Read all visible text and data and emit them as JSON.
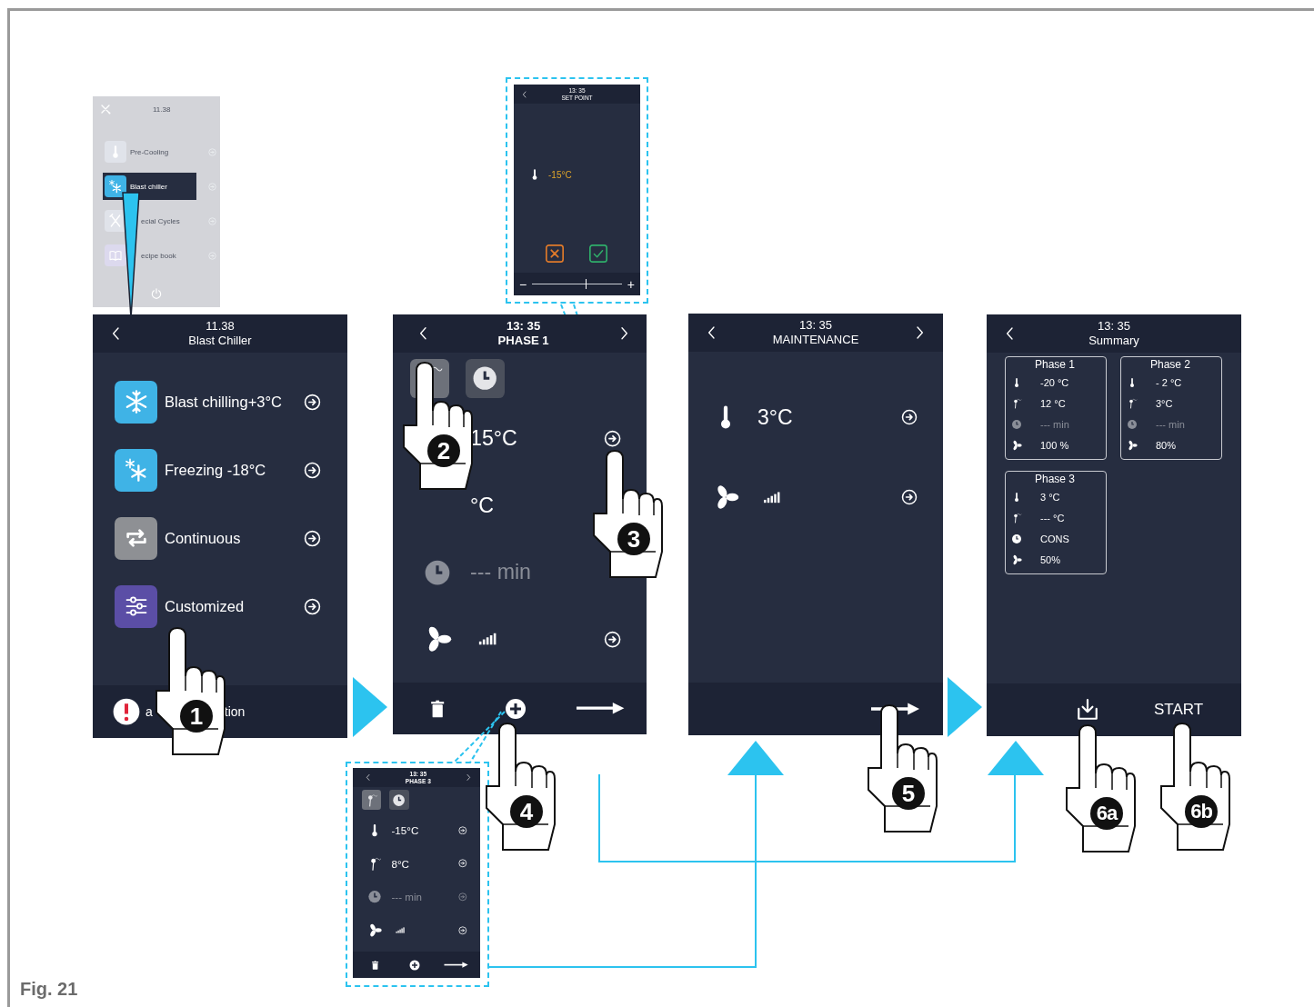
{
  "home_screen": {
    "time": "11.38",
    "items": [
      {
        "label": "Pre-Cooling",
        "kind": "precool",
        "selected": false
      },
      {
        "label": "Blast chiller",
        "kind": "chill",
        "selected": true
      },
      {
        "label": "ecial Cycles",
        "kind": "special",
        "selected": false
      },
      {
        "label": "ecipe book",
        "kind": "recipes",
        "selected": false
      }
    ]
  },
  "menu_screen": {
    "time": "11.38",
    "title": "Blast Chiller",
    "items": [
      {
        "label": "Blast chilling+3°C",
        "kind": "chill"
      },
      {
        "label": "Freezing -18°C",
        "kind": "freeze"
      },
      {
        "label": "Continuous",
        "kind": "continuous"
      },
      {
        "label": "Customized",
        "kind": "custom"
      }
    ],
    "footer": [
      "a",
      "tion"
    ]
  },
  "setpoint_screen": {
    "time": "13: 35",
    "title": "SET POINT",
    "value": "-15°C",
    "minus": "−",
    "plus": "+",
    "slider": {
      "level": 0.6
    }
  },
  "phase_screen": {
    "time": "13: 35",
    "title": "PHASE 1",
    "modes": [
      {
        "kind": "probe",
        "selected": true
      },
      {
        "kind": "timer",
        "selected": false
      }
    ],
    "rows": [
      {
        "value": "15°C",
        "disabled": false,
        "arrow": true
      },
      {
        "value": "°C",
        "disabled": false,
        "arrow": false
      },
      {
        "kind": "time",
        "value": "--- min",
        "disabled": true,
        "arrow": false
      },
      {
        "kind": "fan",
        "disabled": false,
        "arrow": true
      }
    ]
  },
  "phase3_screen": {
    "time": "13: 35",
    "title": "PHASE 3",
    "modes": [
      {
        "kind": "probe",
        "selected": true
      },
      {
        "kind": "timer",
        "selected": false
      }
    ],
    "rows": [
      {
        "kind": "air_temp",
        "value": "-15°C",
        "disabled": false,
        "arrow": true
      },
      {
        "kind": "probe_temp",
        "value": "8°C",
        "disabled": false,
        "arrow": true
      },
      {
        "kind": "time",
        "value": "--- min",
        "disabled": true,
        "arrow": true
      },
      {
        "kind": "fan",
        "disabled": false,
        "arrow": true
      }
    ]
  },
  "maintenance_screen": {
    "time": "13: 35",
    "title": "MAINTENANCE",
    "rows": [
      {
        "kind": "air_temp",
        "value": "3°C"
      },
      {
        "kind": "fan"
      }
    ]
  },
  "summary_screen": {
    "time": "13: 35",
    "title": "Summary",
    "phases": [
      {
        "name": "Phase 1",
        "lines": [
          {
            "kind": "air_temp",
            "value": "-20 °C",
            "disabled": false
          },
          {
            "kind": "probe_temp",
            "value": "12 °C",
            "disabled": false
          },
          {
            "kind": "time",
            "value": "--- min",
            "disabled": true
          },
          {
            "kind": "fan",
            "value": "100 %",
            "disabled": false
          }
        ]
      },
      {
        "name": "Phase 2",
        "lines": [
          {
            "kind": "air_temp",
            "value": "- 2 °C",
            "disabled": false
          },
          {
            "kind": "probe_temp",
            "value": "3°C",
            "disabled": false
          },
          {
            "kind": "time",
            "value": "--- min",
            "disabled": true
          },
          {
            "kind": "fan",
            "value": "80%",
            "disabled": false
          }
        ]
      },
      {
        "name": "Phase 3",
        "lines": [
          {
            "kind": "air_temp",
            "value": "3 °C",
            "disabled": false
          },
          {
            "kind": "probe_temp",
            "value": "--- °C",
            "disabled": false
          },
          {
            "kind": "time",
            "value": "CONS",
            "disabled": false
          },
          {
            "kind": "fan",
            "value": "50%",
            "disabled": false
          }
        ]
      }
    ],
    "start": "START"
  },
  "steps": [
    {
      "label": "1"
    },
    {
      "label": "2"
    },
    {
      "label": "3"
    },
    {
      "label": "4"
    },
    {
      "label": "5"
    },
    {
      "label": "6a"
    },
    {
      "label": "6b"
    }
  ],
  "figure_label": "Fig. 21"
}
